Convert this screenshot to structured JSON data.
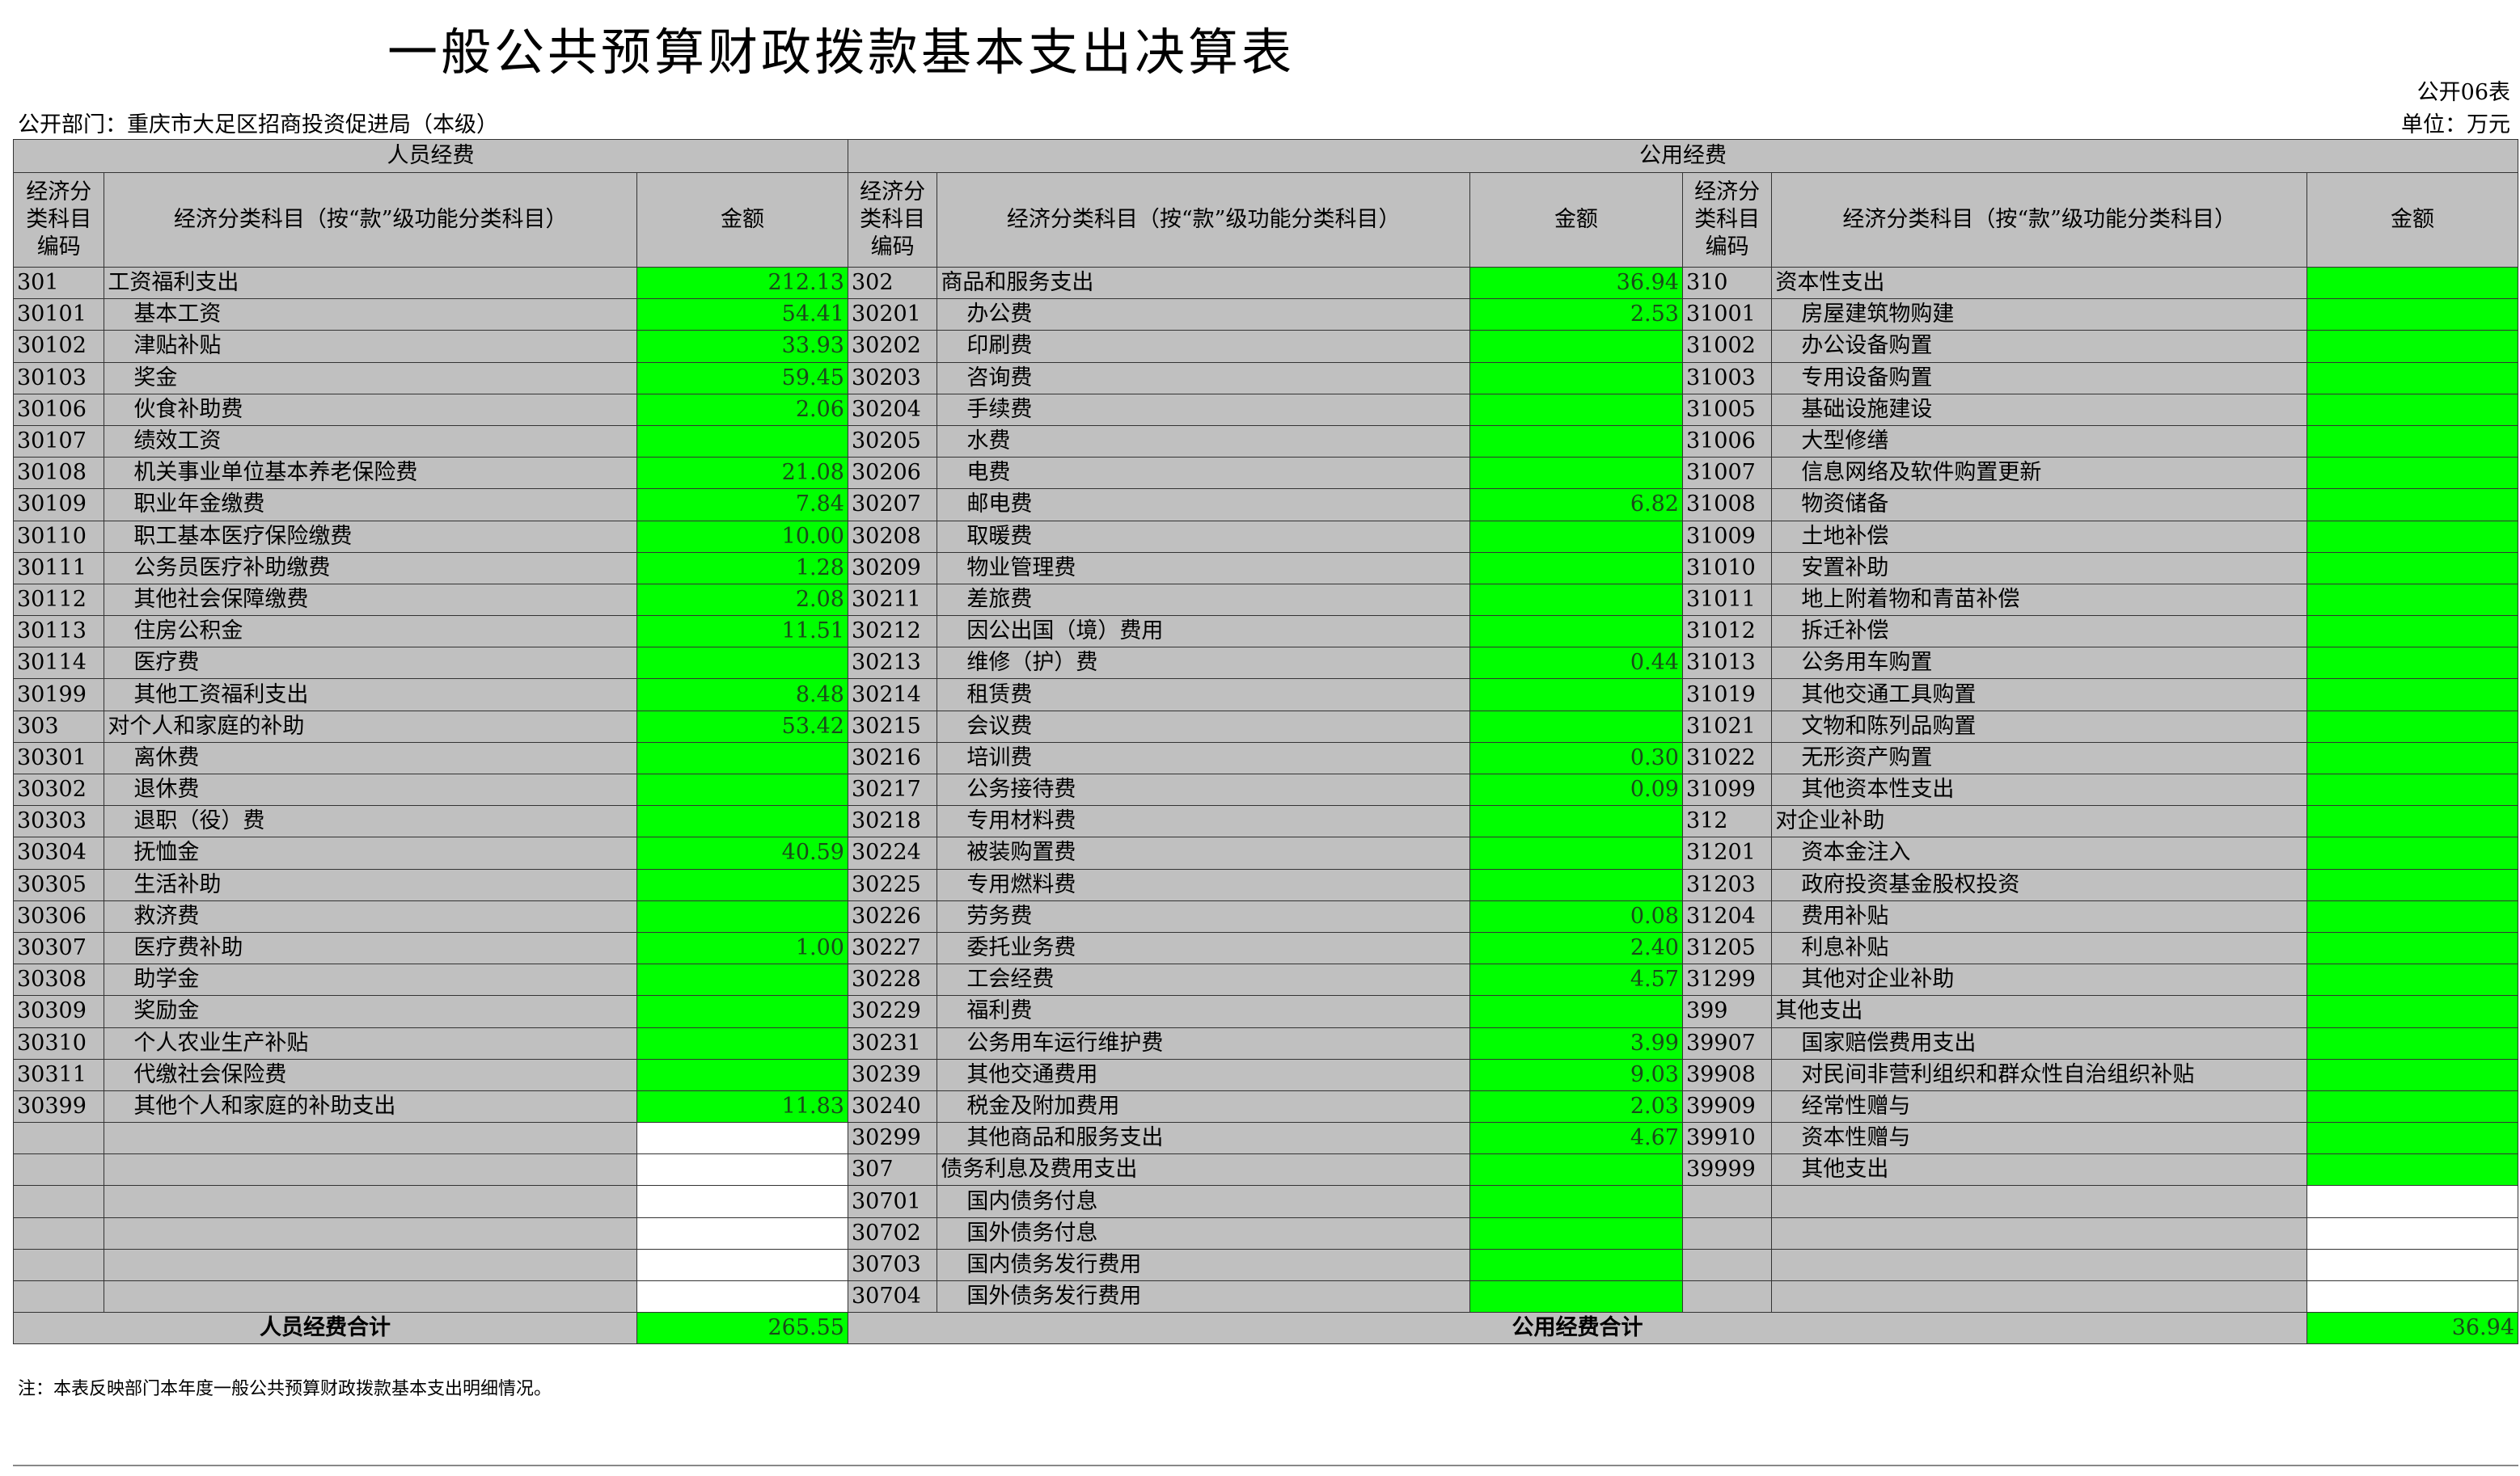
{
  "title": "一般公共预算财政拨款基本支出决算表",
  "form_no": "公开06表",
  "department": "公开部门：重庆市大足区招商投资促进局（本级）",
  "unit": "单位：万元",
  "headers": {
    "personnel": "人员经费",
    "public": "公用经费",
    "code": "经济分类科目编码",
    "name": "经济分类科目（按“款”级功能分类科目）",
    "amount": "金额"
  },
  "colors": {
    "amount_fill": "#00ff00",
    "cell_fill": "#c0c0c0",
    "border": "#333333"
  },
  "rows": [
    {
      "c1": "301",
      "n1": "工资福利支出",
      "a1": "212.13",
      "c2": "302",
      "n2": "商品和服务支出",
      "a2": "36.94",
      "c3": "310",
      "n3": "资本性支出",
      "a3": ""
    },
    {
      "c1": "30101",
      "n1": "基本工资",
      "a1": "54.41",
      "c2": "30201",
      "n2": "办公费",
      "a2": "2.53",
      "c3": "31001",
      "n3": "房屋建筑物购建",
      "a3": ""
    },
    {
      "c1": "30102",
      "n1": "津贴补贴",
      "a1": "33.93",
      "c2": "30202",
      "n2": "印刷费",
      "a2": "",
      "c3": "31002",
      "n3": "办公设备购置",
      "a3": ""
    },
    {
      "c1": "30103",
      "n1": "奖金",
      "a1": "59.45",
      "c2": "30203",
      "n2": "咨询费",
      "a2": "",
      "c3": "31003",
      "n3": "专用设备购置",
      "a3": ""
    },
    {
      "c1": "30106",
      "n1": "伙食补助费",
      "a1": "2.06",
      "c2": "30204",
      "n2": "手续费",
      "a2": "",
      "c3": "31005",
      "n3": "基础设施建设",
      "a3": ""
    },
    {
      "c1": "30107",
      "n1": "绩效工资",
      "a1": "",
      "c2": "30205",
      "n2": "水费",
      "a2": "",
      "c3": "31006",
      "n3": "大型修缮",
      "a3": ""
    },
    {
      "c1": "30108",
      "n1": "机关事业单位基本养老保险费",
      "a1": "21.08",
      "c2": "30206",
      "n2": "电费",
      "a2": "",
      "c3": "31007",
      "n3": "信息网络及软件购置更新",
      "a3": ""
    },
    {
      "c1": "30109",
      "n1": "职业年金缴费",
      "a1": "7.84",
      "c2": "30207",
      "n2": "邮电费",
      "a2": "6.82",
      "c3": "31008",
      "n3": "物资储备",
      "a3": ""
    },
    {
      "c1": "30110",
      "n1": "职工基本医疗保险缴费",
      "a1": "10.00",
      "c2": "30208",
      "n2": "取暖费",
      "a2": "",
      "c3": "31009",
      "n3": "土地补偿",
      "a3": ""
    },
    {
      "c1": "30111",
      "n1": "公务员医疗补助缴费",
      "a1": "1.28",
      "c2": "30209",
      "n2": "物业管理费",
      "a2": "",
      "c3": "31010",
      "n3": "安置补助",
      "a3": ""
    },
    {
      "c1": "30112",
      "n1": "其他社会保障缴费",
      "a1": "2.08",
      "c2": "30211",
      "n2": "差旅费",
      "a2": "",
      "c3": "31011",
      "n3": "地上附着物和青苗补偿",
      "a3": ""
    },
    {
      "c1": "30113",
      "n1": "住房公积金",
      "a1": "11.51",
      "c2": "30212",
      "n2": "因公出国（境）费用",
      "a2": "",
      "c3": "31012",
      "n3": "拆迁补偿",
      "a3": ""
    },
    {
      "c1": "30114",
      "n1": "医疗费",
      "a1": "",
      "c2": "30213",
      "n2": "维修（护）费",
      "a2": "0.44",
      "c3": "31013",
      "n3": "公务用车购置",
      "a3": ""
    },
    {
      "c1": "30199",
      "n1": "其他工资福利支出",
      "a1": "8.48",
      "c2": "30214",
      "n2": "租赁费",
      "a2": "",
      "c3": "31019",
      "n3": "其他交通工具购置",
      "a3": ""
    },
    {
      "c1": "303",
      "n1": "对个人和家庭的补助",
      "a1": "53.42",
      "c2": "30215",
      "n2": "会议费",
      "a2": "",
      "c3": "31021",
      "n3": "文物和陈列品购置",
      "a3": ""
    },
    {
      "c1": "30301",
      "n1": "离休费",
      "a1": "",
      "c2": "30216",
      "n2": "培训费",
      "a2": "0.30",
      "c3": "31022",
      "n3": "无形资产购置",
      "a3": ""
    },
    {
      "c1": "30302",
      "n1": "退休费",
      "a1": "",
      "c2": "30217",
      "n2": "公务接待费",
      "a2": "0.09",
      "c3": "31099",
      "n3": "其他资本性支出",
      "a3": ""
    },
    {
      "c1": "30303",
      "n1": "退职（役）费",
      "a1": "",
      "c2": "30218",
      "n2": "专用材料费",
      "a2": "",
      "c3": "312",
      "n3": "对企业补助",
      "a3": ""
    },
    {
      "c1": "30304",
      "n1": "抚恤金",
      "a1": "40.59",
      "c2": "30224",
      "n2": "被装购置费",
      "a2": "",
      "c3": "31201",
      "n3": "资本金注入",
      "a3": ""
    },
    {
      "c1": "30305",
      "n1": "生活补助",
      "a1": "",
      "c2": "30225",
      "n2": "专用燃料费",
      "a2": "",
      "c3": "31203",
      "n3": "政府投资基金股权投资",
      "a3": ""
    },
    {
      "c1": "30306",
      "n1": "救济费",
      "a1": "",
      "c2": "30226",
      "n2": "劳务费",
      "a2": "0.08",
      "c3": "31204",
      "n3": "费用补贴",
      "a3": ""
    },
    {
      "c1": "30307",
      "n1": "医疗费补助",
      "a1": "1.00",
      "c2": "30227",
      "n2": "委托业务费",
      "a2": "2.40",
      "c3": "31205",
      "n3": "利息补贴",
      "a3": ""
    },
    {
      "c1": "30308",
      "n1": "助学金",
      "a1": "",
      "c2": "30228",
      "n2": "工会经费",
      "a2": "4.57",
      "c3": "31299",
      "n3": "其他对企业补助",
      "a3": ""
    },
    {
      "c1": "30309",
      "n1": "奖励金",
      "a1": "",
      "c2": "30229",
      "n2": "福利费",
      "a2": "",
      "c3": "399",
      "n3": "其他支出",
      "a3": ""
    },
    {
      "c1": "30310",
      "n1": "个人农业生产补贴",
      "a1": "",
      "c2": "30231",
      "n2": "公务用车运行维护费",
      "a2": "3.99",
      "c3": "39907",
      "n3": "国家赔偿费用支出",
      "a3": ""
    },
    {
      "c1": "30311",
      "n1": "代缴社会保险费",
      "a1": "",
      "c2": "30239",
      "n2": "其他交通费用",
      "a2": "9.03",
      "c3": "39908",
      "n3": "对民间非营利组织和群众性自治组织补贴",
      "a3": ""
    },
    {
      "c1": "30399",
      "n1": "其他个人和家庭的补助支出",
      "a1": "11.83",
      "c2": "30240",
      "n2": "税金及附加费用",
      "a2": "2.03",
      "c3": "39909",
      "n3": "经常性赠与",
      "a3": ""
    },
    {
      "c1": "",
      "n1": "",
      "a1": "",
      "c2": "30299",
      "n2": "其他商品和服务支出",
      "a2": "4.67",
      "c3": "39910",
      "n3": "资本性赠与",
      "a3": ""
    },
    {
      "c1": "",
      "n1": "",
      "a1": "",
      "c2": "307",
      "n2": "债务利息及费用支出",
      "a2": "",
      "c3": "39999",
      "n3": "其他支出",
      "a3": ""
    },
    {
      "c1": "",
      "n1": "",
      "a1": "",
      "c2": "30701",
      "n2": "国内债务付息",
      "a2": "",
      "c3": "",
      "n3": "",
      "a3": ""
    },
    {
      "c1": "",
      "n1": "",
      "a1": "",
      "c2": "30702",
      "n2": "国外债务付息",
      "a2": "",
      "c3": "",
      "n3": "",
      "a3": ""
    },
    {
      "c1": "",
      "n1": "",
      "a1": "",
      "c2": "30703",
      "n2": "国内债务发行费用",
      "a2": "",
      "c3": "",
      "n3": "",
      "a3": ""
    },
    {
      "c1": "",
      "n1": "",
      "a1": "",
      "c2": "30704",
      "n2": "国外债务发行费用",
      "a2": "",
      "c3": "",
      "n3": "",
      "a3": ""
    }
  ],
  "totals": {
    "personnel_label": "人员经费合计",
    "personnel_value": "265.55",
    "public_label": "公用经费合计",
    "public_value": "36.94"
  },
  "note": "注：本表反映部门本年度一般公共预算财政拨款基本支出明细情况。"
}
